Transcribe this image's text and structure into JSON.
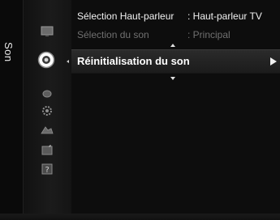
{
  "section_title": "Son",
  "menu": {
    "items": [
      {
        "label": "Sélection Haut-parleur",
        "value": ": Haut-parleur TV",
        "state": "active"
      },
      {
        "label": "Sélection du son",
        "value": ": Principal",
        "state": "dim"
      }
    ],
    "selected": {
      "label": "Réinitialisation du son"
    }
  },
  "icons": {
    "column": [
      "picture-icon",
      "sound-icon",
      "channel-icon",
      "setup-icon",
      "input-icon",
      "application-icon",
      "support-icon"
    ],
    "selected_index": 1
  },
  "colors": {
    "selected_text": "#ffffff",
    "dim_text": "#707070"
  }
}
